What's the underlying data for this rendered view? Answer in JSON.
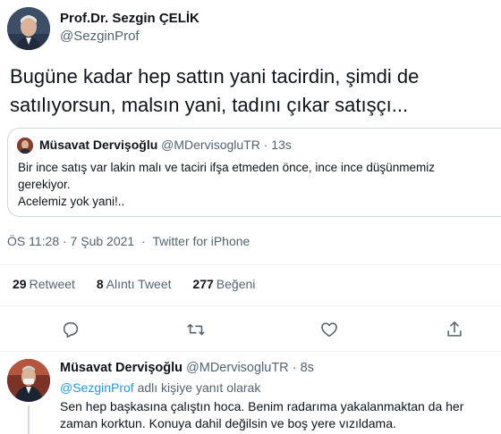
{
  "main_tweet": {
    "author_name": "Prof.Dr. Sezgin ÇELİK",
    "author_handle": "@SezginProf",
    "text_line1": "Bugüne kadar hep sattın yani tacirdin, şimdi de",
    "text_line2": "satılıyorsun, malsın yani, tadını çıkar satışçı...",
    "quote": {
      "author_name": "Müsavat Dervişoğlu",
      "author_handle": "@MDervisogluTR",
      "separator": "·",
      "time": "13s",
      "line1": "Bir ince satış var lakin malı ve taciri ifşa etmeden önce, ince ince düşünmemiz",
      "line2": "gerekiyor.",
      "line3": "Acelemiz yok yani!.."
    },
    "timestamp": "ÖS 11:28 · 7 Şub 2021",
    "meta_separator": "·",
    "source": "Twitter for iPhone",
    "stats": {
      "retweets_count": "29",
      "retweets_label": "Retweet",
      "quotes_count": "8",
      "quotes_label": "Alıntı Tweet",
      "likes_count": "277",
      "likes_label": "Beğeni"
    },
    "icons": {
      "reply": "reply-icon",
      "retweet": "retweet-icon",
      "like": "heart-icon",
      "share": "share-icon"
    }
  },
  "reply_tweet": {
    "author_name": "Müsavat Dervişoğlu",
    "author_handle": "@MDervisogluTR",
    "separator": "·",
    "time": "8s",
    "reply_to_mention": "@SezginProf",
    "reply_to_suffix": "adlı kişiye yanıt olarak",
    "text_line1": "Sen hep başkasına çalıştın hoca. Benim radarıma yakalanmaktan da her",
    "text_line2": "zaman korktun. Konuya dahil değilsin ve boş yere vızıldama."
  },
  "colors": {
    "accent": "#1d9bf0",
    "secondary_text": "#536471",
    "primary_text": "#0f1419",
    "border": "#cfd9de"
  }
}
